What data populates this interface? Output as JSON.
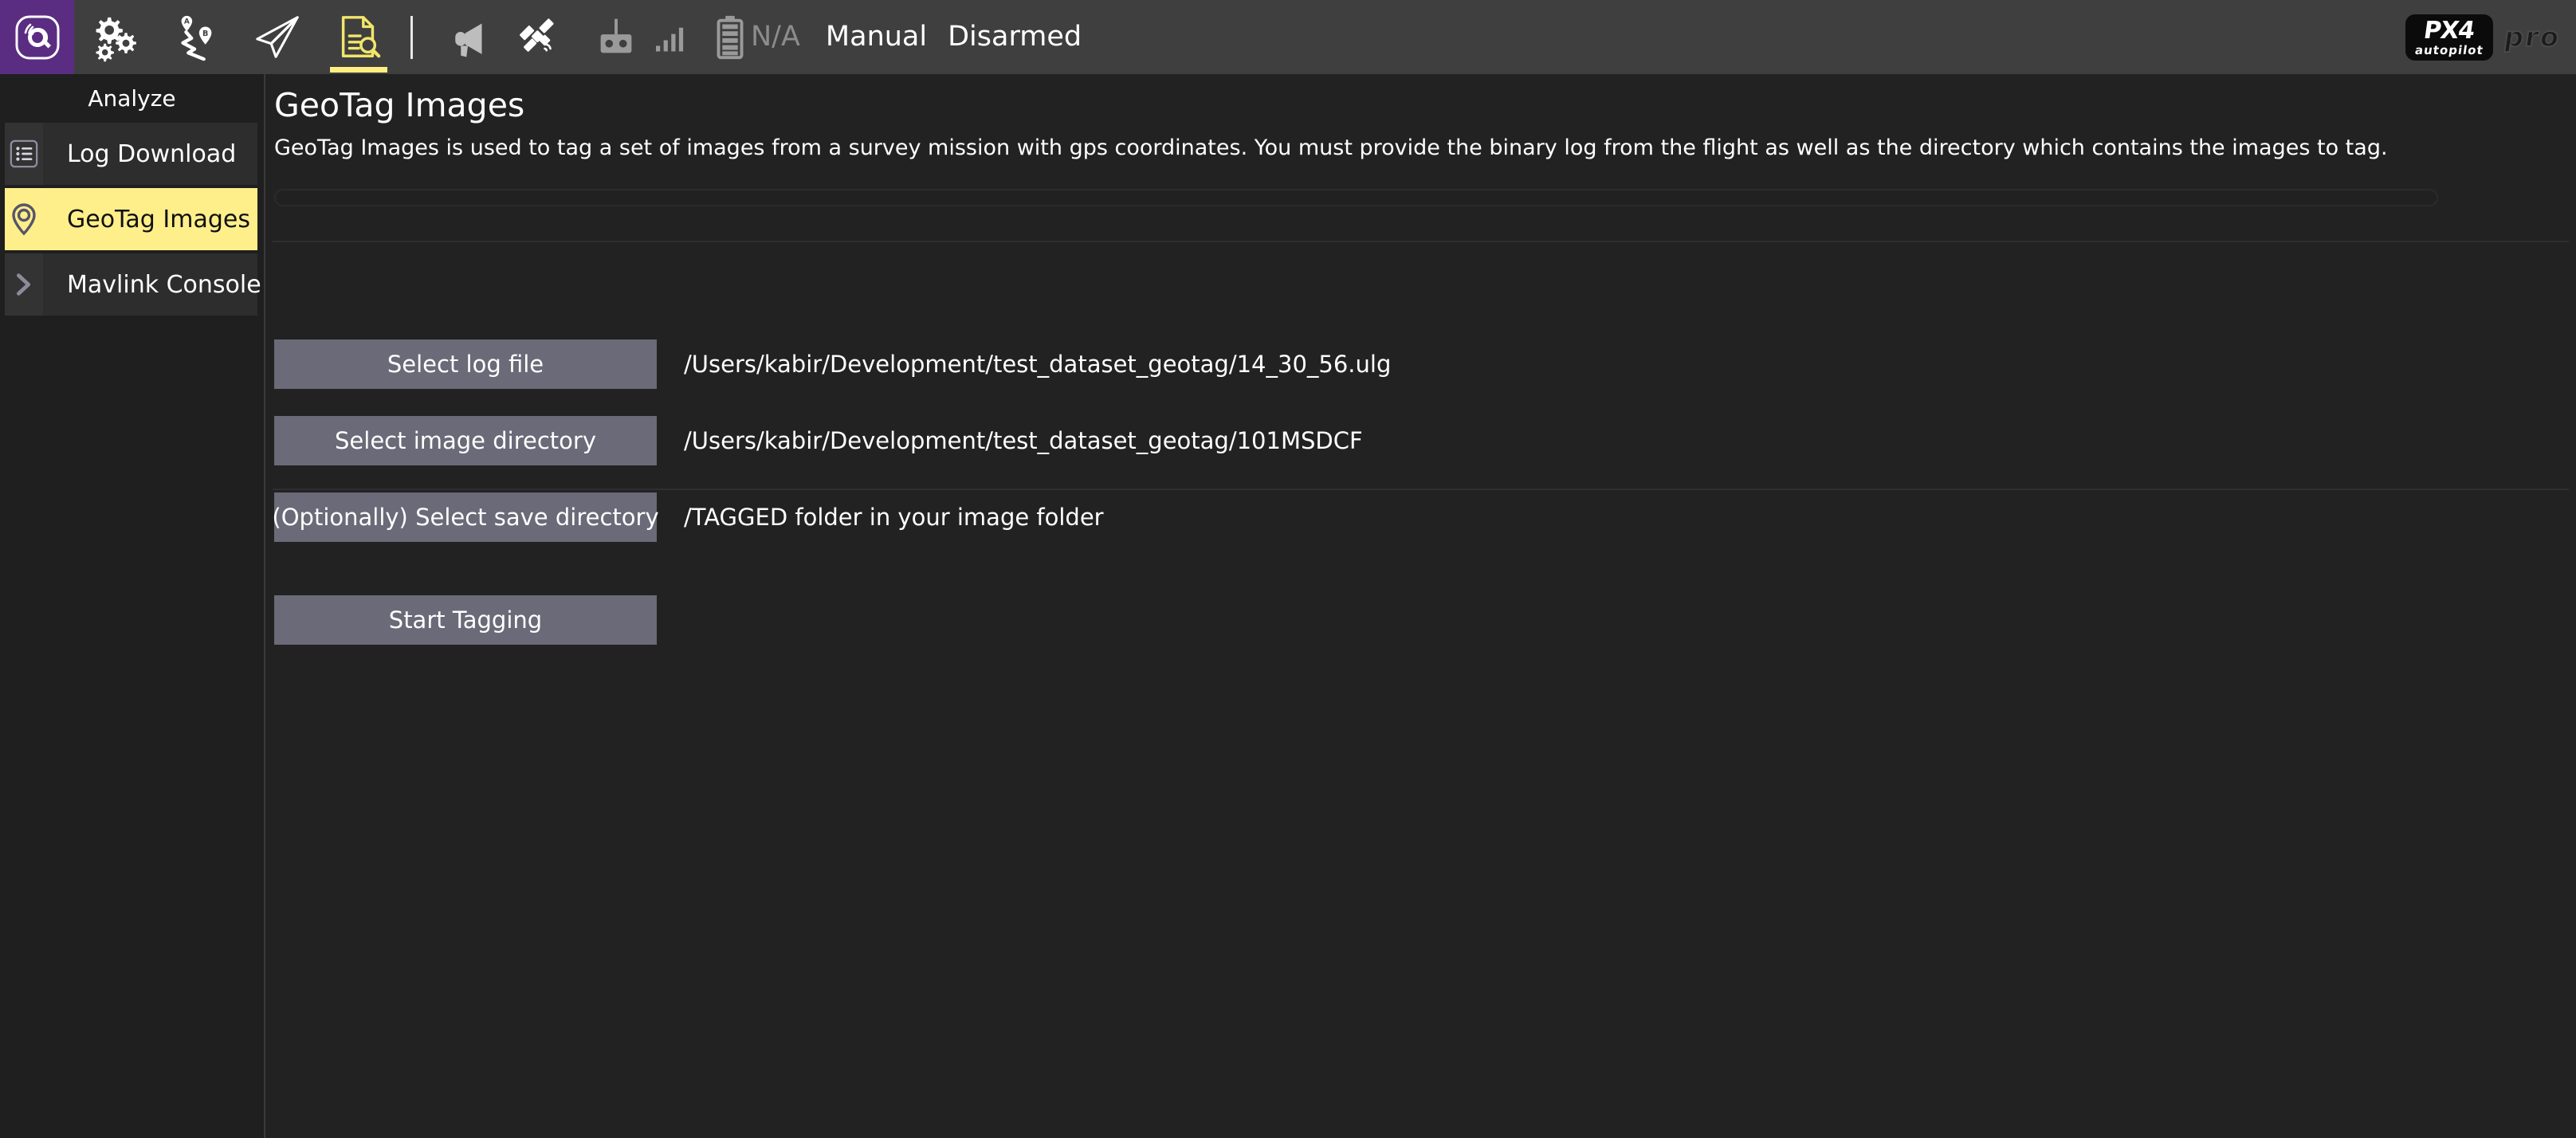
{
  "toolbar": {
    "logo_icon": "qgroundcontrol-logo-icon",
    "items": [
      {
        "name": "tab-settings",
        "icon": "gears-icon",
        "selected": false
      },
      {
        "name": "tab-plan",
        "icon": "waypoints-ab-icon",
        "selected": false
      },
      {
        "name": "tab-fly",
        "icon": "paper-plane-icon",
        "selected": false
      },
      {
        "name": "tab-analyze",
        "icon": "log-search-icon",
        "selected": true
      }
    ],
    "status_icons": [
      {
        "name": "megaphone-icon",
        "icon": "megaphone-icon"
      },
      {
        "name": "satellite-gps-icon",
        "icon": "satellite-icon"
      },
      {
        "name": "rc-controller-icon",
        "icon": "rc-transmitter-icon"
      },
      {
        "name": "telemetry-signal-icon",
        "icon": "signal-bars-icon"
      },
      {
        "name": "battery-icon",
        "icon": "battery-icon"
      }
    ],
    "battery_value": "N/A",
    "flight_mode": "Manual",
    "arm_state": "Disarmed",
    "brand_line1": "PX4",
    "brand_line2": "autopilot",
    "brand_pro": "pro",
    "accent_yellow": "#ffef7f",
    "logo_purple": "#5b2d82"
  },
  "sidebar": {
    "title": "Analyze",
    "items": [
      {
        "label": "Log Download",
        "icon": "list-lines-icon",
        "selected": false,
        "name": "sidebar-item-log-download"
      },
      {
        "label": "GeoTag Images",
        "icon": "map-pin-icon",
        "selected": true,
        "name": "sidebar-item-geotag-images"
      },
      {
        "label": "Mavlink Console",
        "icon": "chevron-right-icon",
        "selected": false,
        "name": "sidebar-item-mavlink-console"
      }
    ],
    "selected_bg": "#ffef8a"
  },
  "main": {
    "title": "GeoTag Images",
    "description": "GeoTag Images is used to tag a set of images from a survey mission with gps coordinates. You must provide the binary log from the flight as well as the directory which contains the images to tag.",
    "progress_percent": 0,
    "rows": [
      {
        "button_label": "Select log file",
        "value": "/Users/kabir/Development/test_dataset_geotag/14_30_56.ulg",
        "button_name": "select-log-file-button",
        "value_name": "log-file-path"
      },
      {
        "button_label": "Select image directory",
        "value": "/Users/kabir/Development/test_dataset_geotag/101MSDCF",
        "button_name": "select-image-directory-button",
        "value_name": "image-directory-path"
      },
      {
        "button_label": "(Optionally) Select save directory",
        "value": "/TAGGED folder in your image folder",
        "button_name": "select-save-directory-button",
        "value_name": "save-directory-path"
      }
    ],
    "start_button_label": "Start Tagging",
    "button_bg": "#6a6a78"
  }
}
